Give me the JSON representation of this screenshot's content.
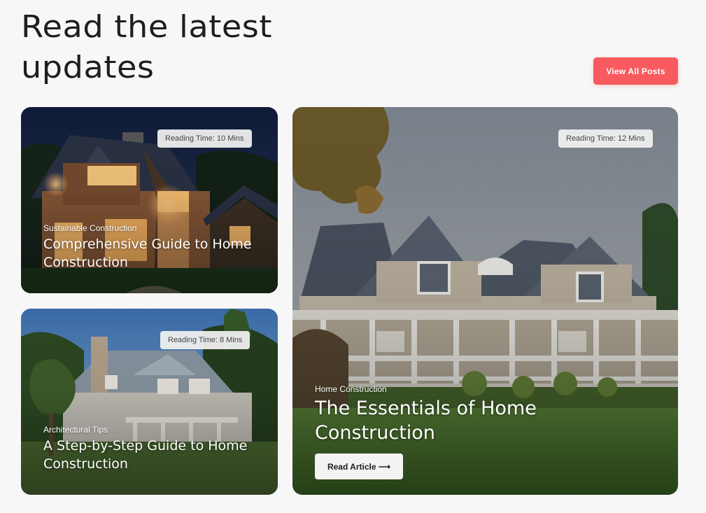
{
  "section": {
    "heading": "Read the latest updates",
    "view_all_label": "View All Posts",
    "accent_color": "#f85a5f"
  },
  "posts": [
    {
      "reading_time": "Reading Time: 10 Mins",
      "category": "Sustainable Construction",
      "title": "Comprehensive Guide to Home Construction"
    },
    {
      "reading_time": "Reading Time: 8 Mins",
      "category": "Architectural Tips",
      "title": "A Step-by-Step Guide to Home Construction"
    },
    {
      "reading_time": "Reading Time: 12 Mins",
      "category": "Home Construction",
      "title": "The Essentials of Home Construction",
      "cta_label": "Read Article ⟶"
    }
  ]
}
